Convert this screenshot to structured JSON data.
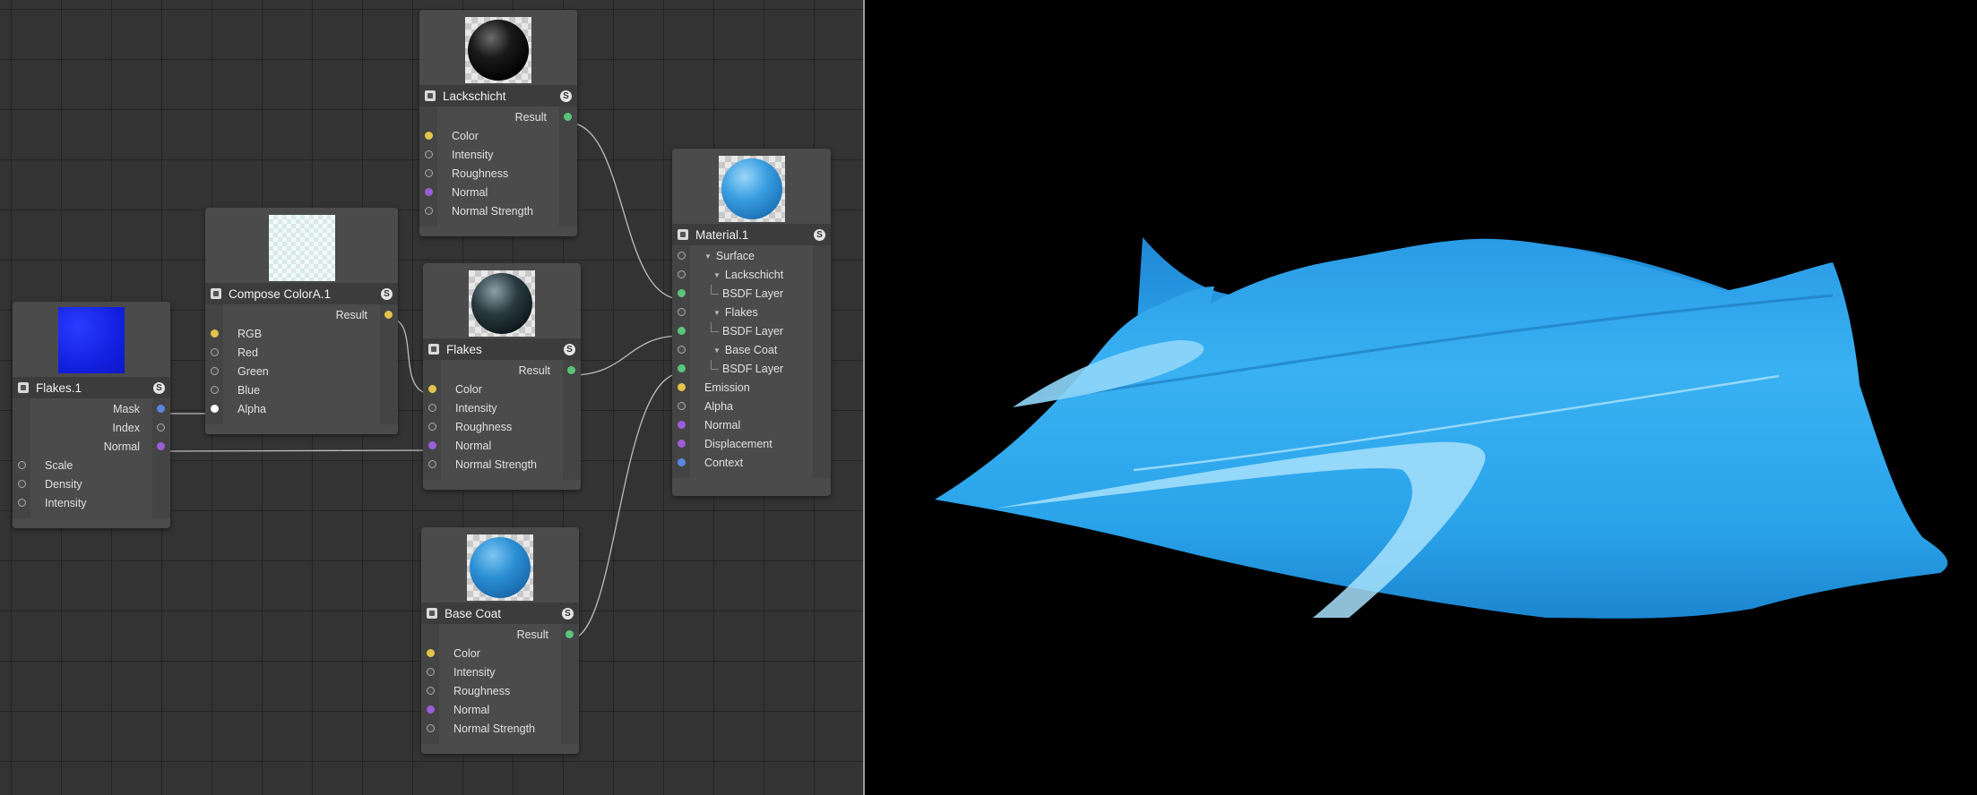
{
  "colors": {
    "port_yellow": "#e2c34a",
    "port_green": "#5ac47a",
    "port_purple": "#9a5ed8",
    "port_blue": "#5b86e0",
    "port_grey": "#9a9a9a",
    "surface_blue": "#33aaf0"
  },
  "nodes": {
    "flakes1": {
      "title": "Flakes.1",
      "badge": "S",
      "icon": "node-type-icon",
      "outputs": [
        {
          "label": "Mask",
          "color": "#5b86e0"
        },
        {
          "label": "Index",
          "color": ""
        },
        {
          "label": "Normal",
          "color": "#9a5ed8"
        }
      ],
      "inputs": [
        {
          "label": "Scale",
          "color": ""
        },
        {
          "label": "Density",
          "color": ""
        },
        {
          "label": "Intensity",
          "color": ""
        }
      ]
    },
    "compose": {
      "title": "Compose ColorA.1",
      "badge": "S",
      "outputs": [
        {
          "label": "Result",
          "color": "#e2c34a"
        }
      ],
      "inputs": [
        {
          "label": "RGB",
          "color": "#e2c34a"
        },
        {
          "label": "Red",
          "color": ""
        },
        {
          "label": "Green",
          "color": ""
        },
        {
          "label": "Blue",
          "color": ""
        },
        {
          "label": "Alpha",
          "color": "#ffffff"
        }
      ]
    },
    "lackschicht": {
      "title": "Lackschicht",
      "badge": "S",
      "outputs": [
        {
          "label": "Result",
          "color": "#5ac47a"
        }
      ],
      "inputs": [
        {
          "label": "Color",
          "color": "#e2c34a"
        },
        {
          "label": "Intensity",
          "color": ""
        },
        {
          "label": "Roughness",
          "color": ""
        },
        {
          "label": "Normal",
          "color": "#9a5ed8"
        },
        {
          "label": "Normal Strength",
          "color": ""
        }
      ]
    },
    "flakes": {
      "title": "Flakes",
      "badge": "S",
      "outputs": [
        {
          "label": "Result",
          "color": "#5ac47a"
        }
      ],
      "inputs": [
        {
          "label": "Color",
          "color": "#e2c34a"
        },
        {
          "label": "Intensity",
          "color": ""
        },
        {
          "label": "Roughness",
          "color": ""
        },
        {
          "label": "Normal",
          "color": "#9a5ed8"
        },
        {
          "label": "Normal Strength",
          "color": ""
        }
      ]
    },
    "basecoat": {
      "title": "Base Coat",
      "badge": "S",
      "outputs": [
        {
          "label": "Result",
          "color": "#5ac47a"
        }
      ],
      "inputs": [
        {
          "label": "Color",
          "color": "#e2c34a"
        },
        {
          "label": "Intensity",
          "color": ""
        },
        {
          "label": "Roughness",
          "color": ""
        },
        {
          "label": "Normal",
          "color": "#9a5ed8"
        },
        {
          "label": "Normal Strength",
          "color": ""
        }
      ]
    },
    "material": {
      "title": "Material.1",
      "badge": "S",
      "rows": [
        {
          "label": "Surface",
          "kind": "group",
          "level": 0,
          "color": ""
        },
        {
          "label": "Lackschicht",
          "kind": "group",
          "level": 1,
          "color": ""
        },
        {
          "label": "BSDF Layer",
          "kind": "leaf",
          "level": 2,
          "color": "#5ac47a"
        },
        {
          "label": "Flakes",
          "kind": "group",
          "level": 1,
          "color": ""
        },
        {
          "label": "BSDF Layer",
          "kind": "leaf",
          "level": 2,
          "color": "#5ac47a"
        },
        {
          "label": "Base Coat",
          "kind": "group",
          "level": 1,
          "color": ""
        },
        {
          "label": "BSDF Layer",
          "kind": "leaf",
          "level": 2,
          "color": "#5ac47a"
        },
        {
          "label": "Emission",
          "kind": "port",
          "level": 0,
          "color": "#e2c34a"
        },
        {
          "label": "Alpha",
          "kind": "port",
          "level": 0,
          "color": ""
        },
        {
          "label": "Normal",
          "kind": "port",
          "level": 0,
          "color": "#9a5ed8"
        },
        {
          "label": "Displacement",
          "kind": "port",
          "level": 0,
          "color": "#9a5ed8"
        },
        {
          "label": "Context",
          "kind": "port",
          "level": 0,
          "color": "#5b86e0"
        }
      ]
    }
  }
}
